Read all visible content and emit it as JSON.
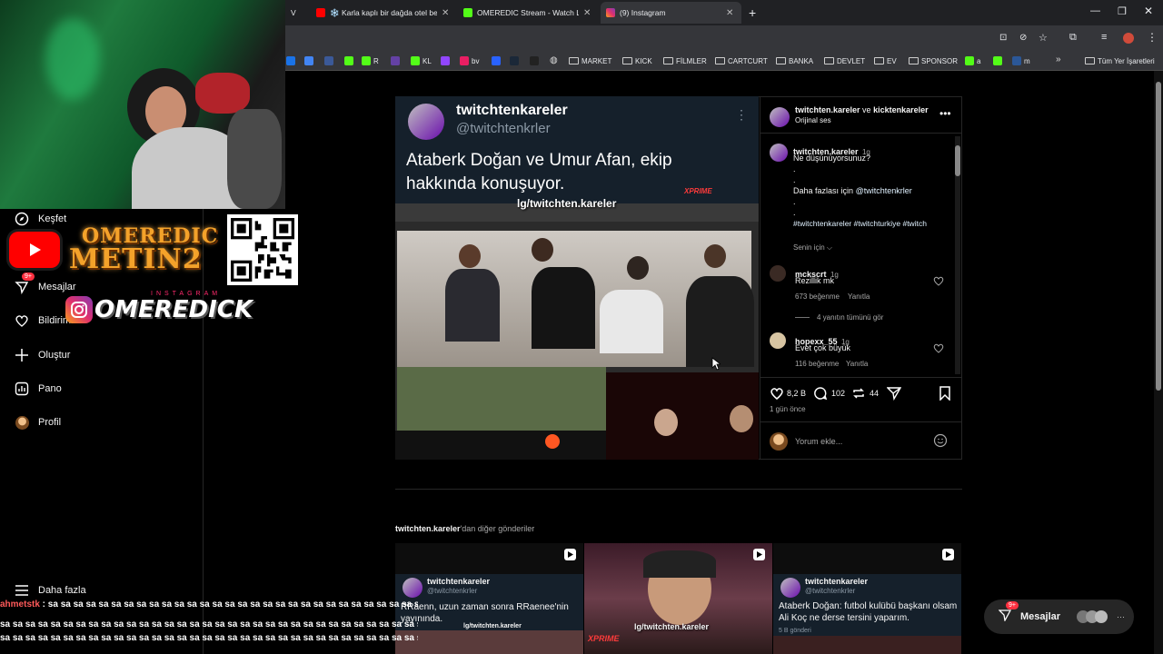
{
  "browser": {
    "tabs": [
      {
        "label": "V",
        "active": false
      },
      {
        "label": "❄️ Karla kaplı bir dağda otel be",
        "active": false
      },
      {
        "label": "OMEREDIC Stream - Watch Live",
        "active": false
      },
      {
        "label": "(9) Instagram",
        "active": true
      }
    ],
    "bookmarks": [
      "KL",
      "R",
      "bv",
      "MARKET",
      "KICK",
      "FİLMLER",
      "CARTCURT",
      "BANKA",
      "DEVLET",
      "EV",
      "SPONSOR",
      "a",
      "m"
    ],
    "all_bookmarks": "Tüm Yer İşaretleri"
  },
  "overlay": {
    "metin_line1": "OMEREDIC",
    "metin_line2": "METIN2",
    "instagram_small": "INSTAGRAM",
    "instagram_name": "OMEREDICK"
  },
  "sidebar": {
    "items": [
      {
        "label": "Keşfet"
      },
      {
        "label": "Mesajlar",
        "badge": "9+"
      },
      {
        "label": "Bildirimler"
      },
      {
        "label": "Oluştur"
      },
      {
        "label": "Pano"
      },
      {
        "label": "Profil"
      }
    ],
    "more": "Daha fazla"
  },
  "post": {
    "tweet_name": "twitchtenkareler",
    "tweet_handle": "@twitchtenkrler",
    "tweet_text": "Ataberk Doğan ve Umur Afan, ekip hakkında konuşuyor.",
    "watermark": "lg/twitchten.kareler",
    "xprime": "XPRIME",
    "header_user1": "twitchten.kareler",
    "header_and": "ve",
    "header_user2": "kicktenkareler",
    "header_audio": "Orijinal ses",
    "caption_user": "twitchten.kareler",
    "caption_time": "1g",
    "caption_line1": "Ne düşünüyorsunuz?",
    "caption_more": "Daha fazlası için",
    "caption_mention": "@twitchtenkrler",
    "caption_tags": "#twitchtenkareler #twitchturkiye #twitch",
    "for_you": "Senin için",
    "comments": [
      {
        "user": "mckscrt",
        "time": "1g",
        "text": "Rezillik mk",
        "likes": "673 beğenme",
        "reply": "Yanıtla",
        "view_replies": "4 yanıtın tümünü gör"
      },
      {
        "user": "hopexx_55",
        "time": "1g",
        "text": "Evet çok büyük",
        "likes": "116 beğenme",
        "reply": "Yanıtla"
      }
    ],
    "likes": "8,2 B",
    "comments_count": "102",
    "reposts": "44",
    "posted": "1 gün önce",
    "comment_placeholder": "Yorum ekle..."
  },
  "more_posts": {
    "heading_user": "twitchten.kareler",
    "heading_suffix": "'dan diğer gönderiler",
    "cards": [
      {
        "name": "twitchtenkareler",
        "handle": "@twitchtenkrler",
        "text": "RRaenn, uzun zaman sonra RRaenee'nin yayınında.",
        "watermark": "lg/twitchten.kareler"
      },
      {
        "watermark": "lg/twitchten.kareler",
        "xprime": "XPRIME"
      },
      {
        "name": "twitchtenkareler",
        "handle": "@twitchtenkrler",
        "text": "Ataberk Doğan: futbol kulübü başkanı olsam Ali Koç ne derse tersini yaparım.",
        "footer": "5 B gönderi"
      }
    ]
  },
  "chat": {
    "user": "ahmetstk",
    "line1": "sa sa sa sa sa sa sa sa sa sa sa sa sa sa sa sa sa sa sa sa sa sa sa sa sa sa sa sa sa sa sa",
    "line2": "sa sa sa sa sa sa sa sa sa sa sa sa sa sa sa sa sa sa sa sa sa sa sa sa sa sa sa sa sa sa sa sa sa sa sa sa sa",
    "line3": "sa sa sa sa sa sa sa sa sa sa sa sa sa sa sa sa sa sa sa sa sa sa sa sa sa sa sa sa sa sa sa sa sa sa"
  },
  "messages_bar": {
    "label": "Mesajlar",
    "badge": "9+"
  },
  "colors": {
    "accent": "#0095f6",
    "mention": "#e0f1ff",
    "badge": "#ff3040",
    "bg": "#000000"
  }
}
